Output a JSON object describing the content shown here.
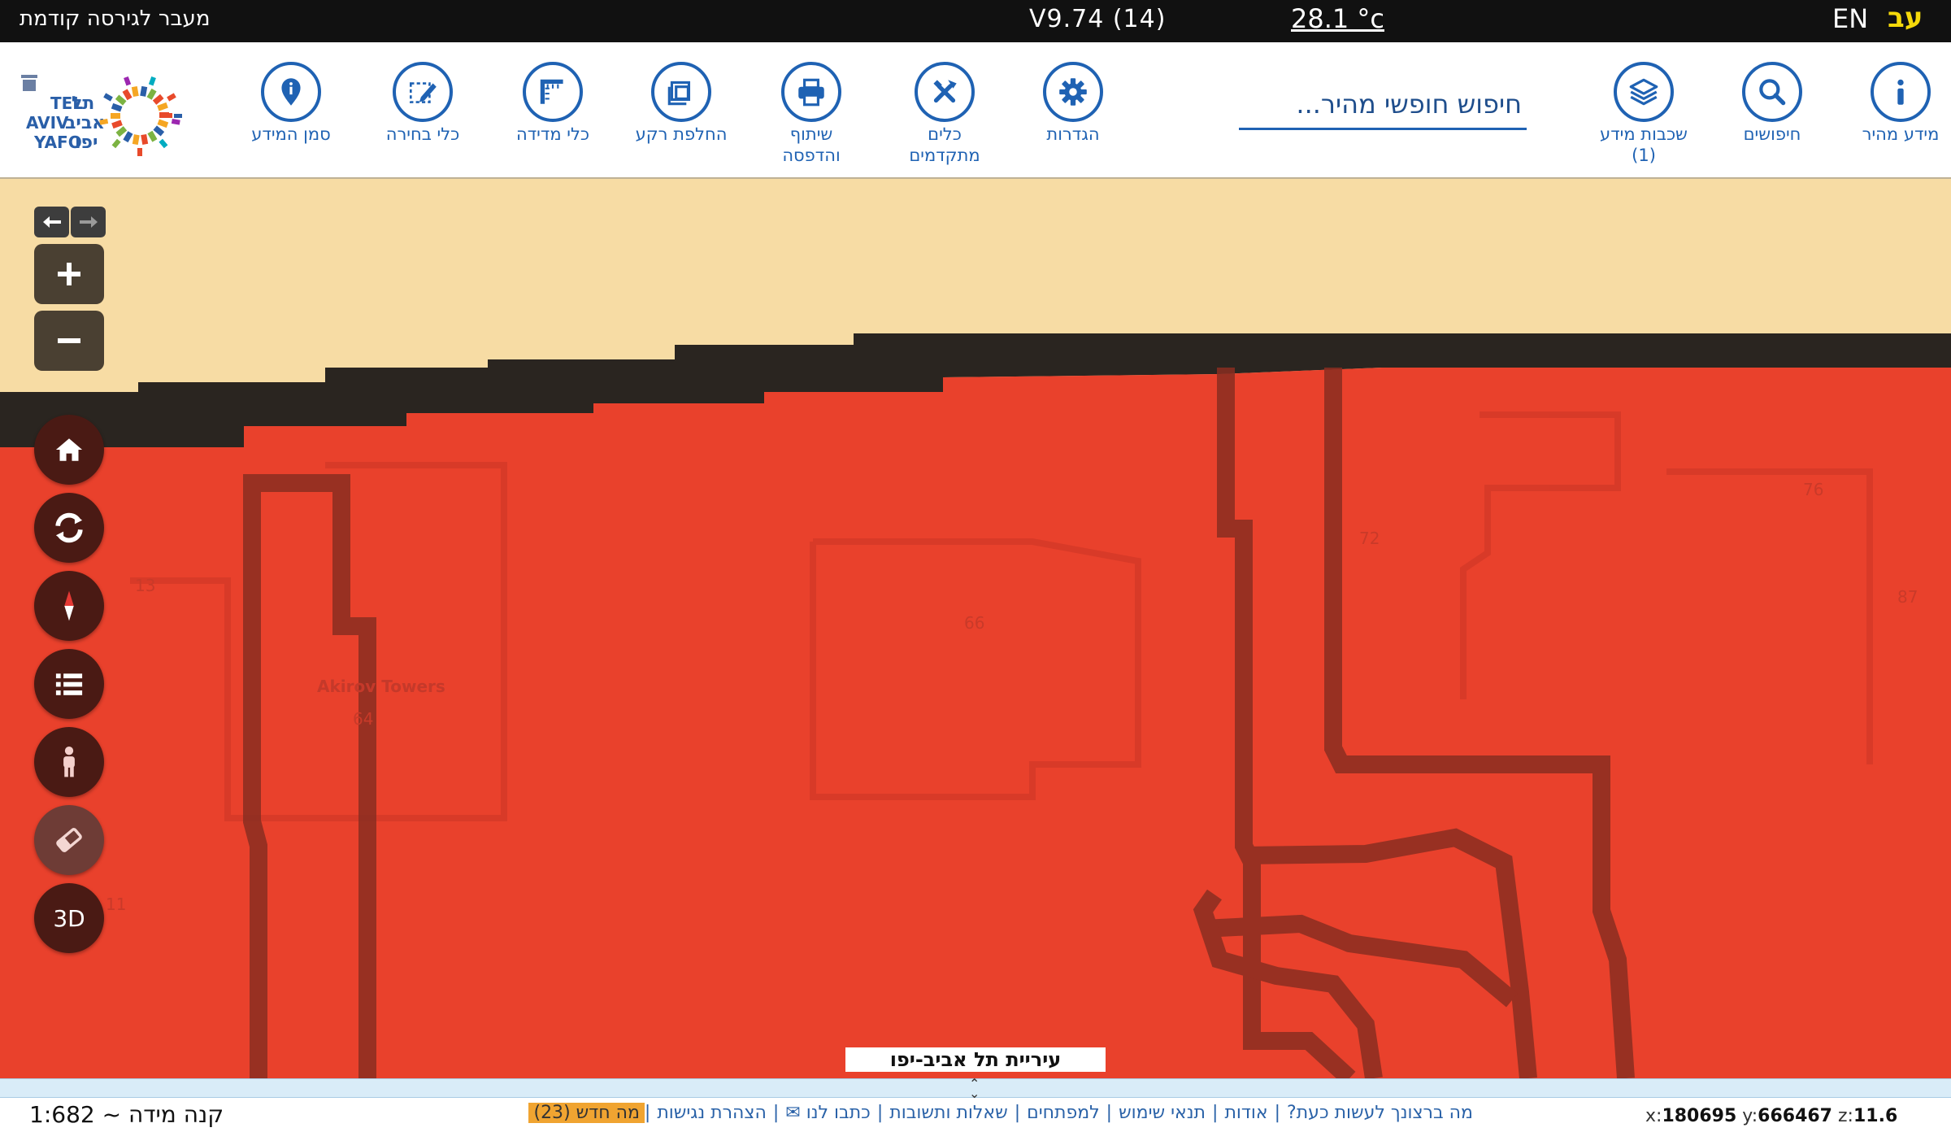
{
  "topbar": {
    "prev_version": "מעבר לגירסה קודמת",
    "version": "V9.74 (14)",
    "temperature": "28.1 °c",
    "lang_en": "EN",
    "lang_he": "עב"
  },
  "toolbar": {
    "items": [
      {
        "label": "מידע מהיר",
        "icon": "info-icon"
      },
      {
        "label": "חיפושים",
        "icon": "search-icon"
      },
      {
        "label": "שכבות מידע (1)",
        "icon": "layers-icon"
      },
      {
        "label": "הגדרות",
        "icon": "gear-icon"
      },
      {
        "label": "כלים מתקדמים",
        "icon": "tools-icon"
      },
      {
        "label": "שיתוף והדפסה",
        "icon": "printer-icon"
      },
      {
        "label": "החלפת רקע",
        "icon": "background-swap-icon"
      },
      {
        "label": "כלי מדידה",
        "icon": "ruler-icon"
      },
      {
        "label": "כלי בחירה",
        "icon": "select-edit-icon"
      },
      {
        "label": "סמן המידע",
        "icon": "map-pin-icon"
      }
    ],
    "search_placeholder": "חיפוש חופשי מהיר...",
    "logo_text": {
      "en_line1": "TEL",
      "en_line2": "AVIV",
      "en_line3": "YAFO",
      "he_line1": "תל",
      "he_line2": "אביב",
      "he_line3": "יפו"
    }
  },
  "map": {
    "labels": {
      "n13": "13",
      "n11": "11",
      "n64": "64",
      "n66": "66",
      "n72": "72",
      "n76": "76",
      "n87": "87"
    },
    "building_name": "Akirov Towers",
    "city_label": "עיריית תל אביב-יפו",
    "controls": [
      "arrow-left-icon",
      "arrow-right-icon",
      "zoom-in-icon",
      "zoom-out-icon",
      "home-icon",
      "refresh-icon",
      "compass-icon",
      "list-icon",
      "person-icon",
      "eraser-icon",
      "3d"
    ],
    "label_3d": "3D"
  },
  "status": {
    "scale": "קנה מידה ~ 1:682",
    "links": [
      "מה ברצונך לעשות כעת?",
      "אודות",
      "תנאי שימוש",
      "למפתחים",
      "שאלות ותשובות",
      "כתבו לנו ✉",
      "הצהרת נגישות"
    ],
    "news": "מה חדש (23)",
    "coords": {
      "x_label": "x:",
      "x": "180695",
      "y_label": "y:",
      "y": "666467",
      "z_label": "z:",
      "z": "11.6"
    }
  },
  "colors": {
    "accent_blue": "#1f62b3",
    "map_red": "#e9412c",
    "beige": "#f7dca4",
    "news_orange": "#f0a431",
    "lang_yellow": "#f5d90a"
  }
}
